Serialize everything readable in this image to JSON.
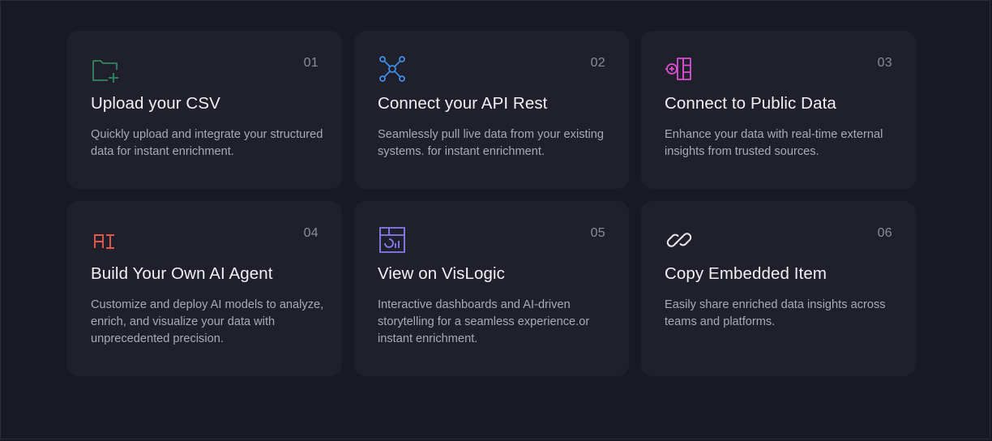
{
  "cards": [
    {
      "number": "01",
      "icon": "folder-plus-icon",
      "title": "Upload your CSV",
      "description": "Quickly upload and integrate your structured data for instant enrichment."
    },
    {
      "number": "02",
      "icon": "api-network-icon",
      "title": "Connect your API Rest",
      "description": "Seamlessly pull live data from your existing systems. for instant enrichment."
    },
    {
      "number": "03",
      "icon": "public-data-icon",
      "title": "Connect to Public Data",
      "description": "Enhance your data with real-time external insights from trusted sources."
    },
    {
      "number": "04",
      "icon": "ai-icon",
      "icon_text": "AI",
      "title": "Build Your Own AI Agent",
      "description": "Customize and deploy AI models to analyze, enrich, and visualize your data with unprecedented precision."
    },
    {
      "number": "05",
      "icon": "dashboard-icon",
      "title": "View on VisLogic",
      "description": "Interactive dashboards and AI-driven storytelling for a seamless experience.or instant enrichment."
    },
    {
      "number": "06",
      "icon": "link-icon",
      "title": "Copy Embedded Item",
      "description": "Easily share enriched data insights across teams and platforms."
    }
  ],
  "colors": {
    "background": "#171923",
    "card": "#1f202b",
    "upload_icon": "#2f8a5e",
    "api_icon": "#3d8ee6",
    "public_data_icon": "#d84fd0",
    "ai_icon": "#e35a4a",
    "dashboard_icon": "#8d7bf0",
    "link_icon": "#e8e8ec"
  }
}
